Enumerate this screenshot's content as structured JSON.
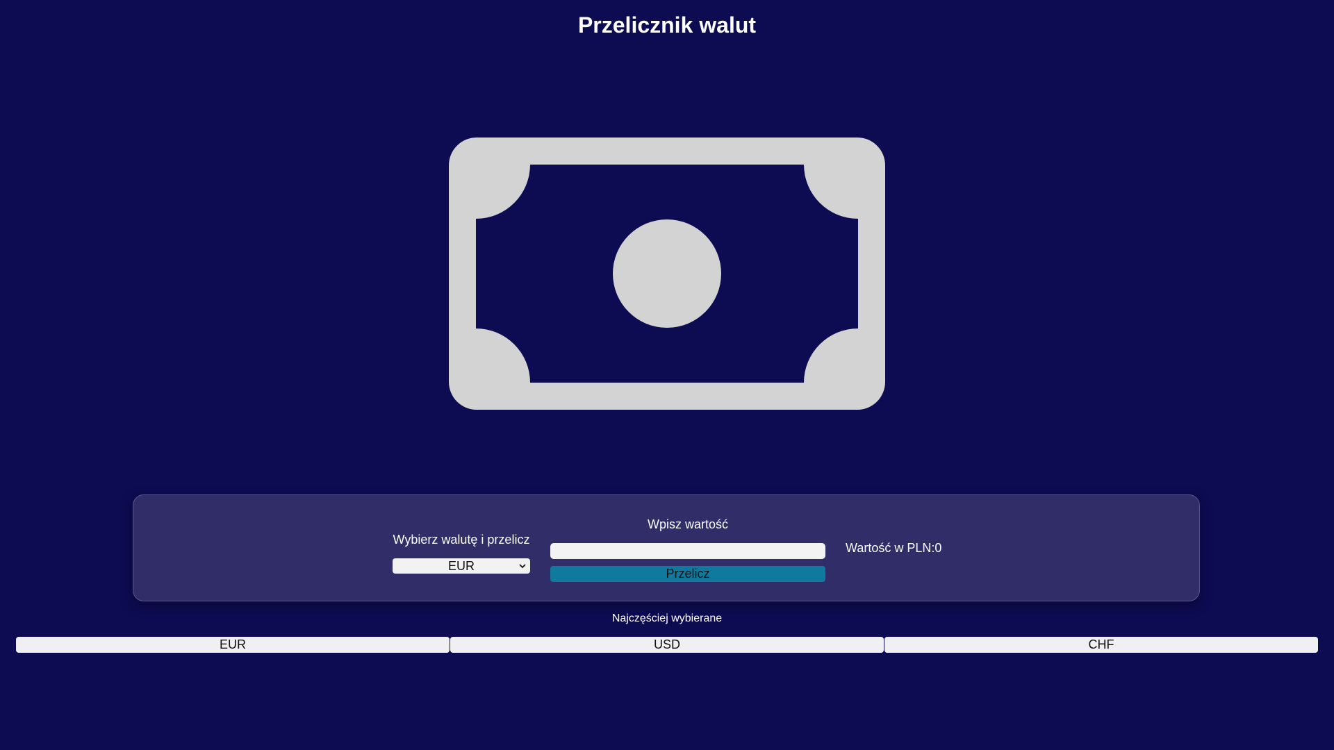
{
  "page": {
    "title": "Przelicznik walut"
  },
  "hero": {
    "icon": "banknote-icon",
    "icon_color": "#d3d3d3"
  },
  "converter": {
    "select_label": "Wybierz walutę i przelicz",
    "selected_currency": "EUR",
    "input_label": "Wpisz wartość",
    "input_value": "",
    "convert_label": "Przelicz",
    "result_text": "Wartość w PLN:0"
  },
  "favorites": {
    "label": "Najczęściej wybierane",
    "items": [
      "EUR",
      "USD",
      "CHF"
    ]
  },
  "colors": {
    "background": "#0d0b52",
    "panel": "#302d69",
    "accent_button": "#0f7a9e"
  }
}
